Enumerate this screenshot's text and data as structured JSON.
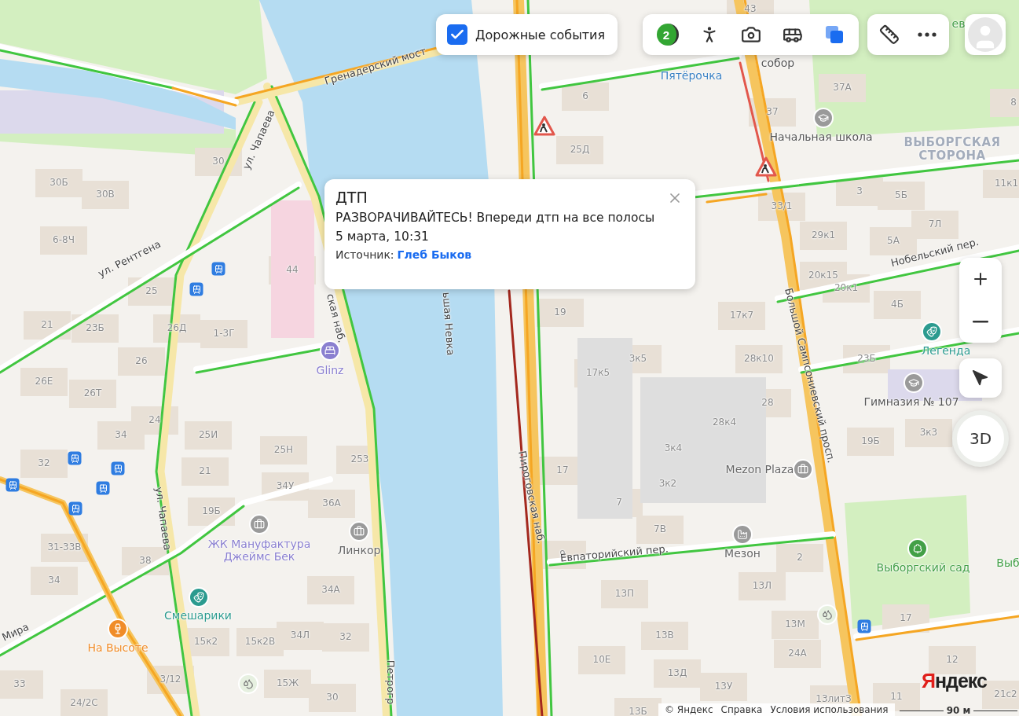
{
  "traffic_toggle": {
    "label": "Дорожные события",
    "checked": true
  },
  "toolbar": {
    "tools": [
      {
        "kind": "traffic",
        "badge": "2",
        "selected": false
      },
      {
        "kind": "panorama",
        "selected": false
      },
      {
        "kind": "camera",
        "selected": false
      },
      {
        "kind": "transit",
        "selected": false
      },
      {
        "kind": "layers",
        "selected": true
      }
    ],
    "utilities": [
      {
        "kind": "ruler"
      },
      {
        "kind": "more"
      }
    ]
  },
  "incident_popup": {
    "title": "ДТП",
    "message": "РАЗВОРАЧИВАЙТЕСЬ! Впереди дтп на все полосы",
    "date": "5 марта, 10:31",
    "source_label": "Источник:",
    "source_name": "Глеб Быков"
  },
  "map": {
    "streets": [
      "Гренадерский мост",
      "ул. Чапаева",
      "ул. Рентгена",
      "ская наб.",
      "ьшая Невка",
      "Пироговская наб.",
      "Большой Сампсониевский просп.",
      "Нобельский пер.",
      "Евпаторийский пер.",
      "ул. Чапаева",
      "Мира",
      "Петрогр"
    ],
    "district": "ВЫБОРГСКАЯ СТОРОНА",
    "places": [
      {
        "name": "Пятёрочка",
        "color": "#3b82c4"
      },
      {
        "name": "собор",
        "color": "#555555"
      },
      {
        "name": "Начальная школа",
        "color": "#555555"
      },
      {
        "name": "Легенда",
        "color": "#2b9b8f"
      },
      {
        "name": "Гимназия № 107",
        "color": "#555555"
      },
      {
        "name": "Mezon Plaza",
        "color": "#666666"
      },
      {
        "name": "Мезон",
        "color": "#666666"
      },
      {
        "name": "Выборгский сад",
        "color": "#43a047"
      },
      {
        "name": "Выб",
        "color": "#43a047"
      },
      {
        "name": "ев",
        "color": "#43a047"
      },
      {
        "name": "Glinz",
        "color": "#8a7fd0"
      },
      {
        "name": "ЖК Мануфактура Джеймс Бек",
        "color": "#8a7fd0"
      },
      {
        "name": "Линкор",
        "color": "#666666"
      },
      {
        "name": "Смешарики",
        "color": "#2b9b8f"
      },
      {
        "name": "На Высоте",
        "color": "#f08c28"
      }
    ],
    "house_numbers": [
      "43",
      "6",
      "25Д",
      "37А",
      "37",
      "8",
      "3",
      "5Б",
      "11к1",
      "33/1",
      "7Л",
      "29к1",
      "5А",
      "20к15",
      "20к1",
      "4Б",
      "19",
      "17к7",
      "3к5",
      "28к10",
      "23Б",
      "17к5",
      "28",
      "28к4",
      "3к4",
      "3к3",
      "19Б",
      "17",
      "3к2",
      "7",
      "7В",
      "9",
      "2",
      "13П",
      "13Л",
      "13М",
      "13В",
      "24А",
      "10Е",
      "13Д",
      "13У",
      "13литЗ",
      "11",
      "12",
      "21с2",
      "13Б",
      "17",
      "30",
      "30Б",
      "30В",
      "6-8Ч",
      "44",
      "25",
      "21",
      "23Б",
      "26Д",
      "1-3Г",
      "26",
      "26Е",
      "26Т",
      "24",
      "34",
      "25И",
      "25Н",
      "253",
      "32",
      "21",
      "34У",
      "36А",
      "19Б",
      "31-33В",
      "38",
      "34",
      "34А",
      "15к2",
      "15к2В",
      "34Л",
      "32",
      "33",
      "3/12",
      "15Ж",
      "30",
      "24/2С"
    ]
  },
  "map_controls": {
    "compass_label": "3D"
  },
  "logo": "Яндекс",
  "footer": {
    "links": [
      "© Яндекс",
      "Справка",
      "Условия использования"
    ],
    "scale": "90 м"
  }
}
